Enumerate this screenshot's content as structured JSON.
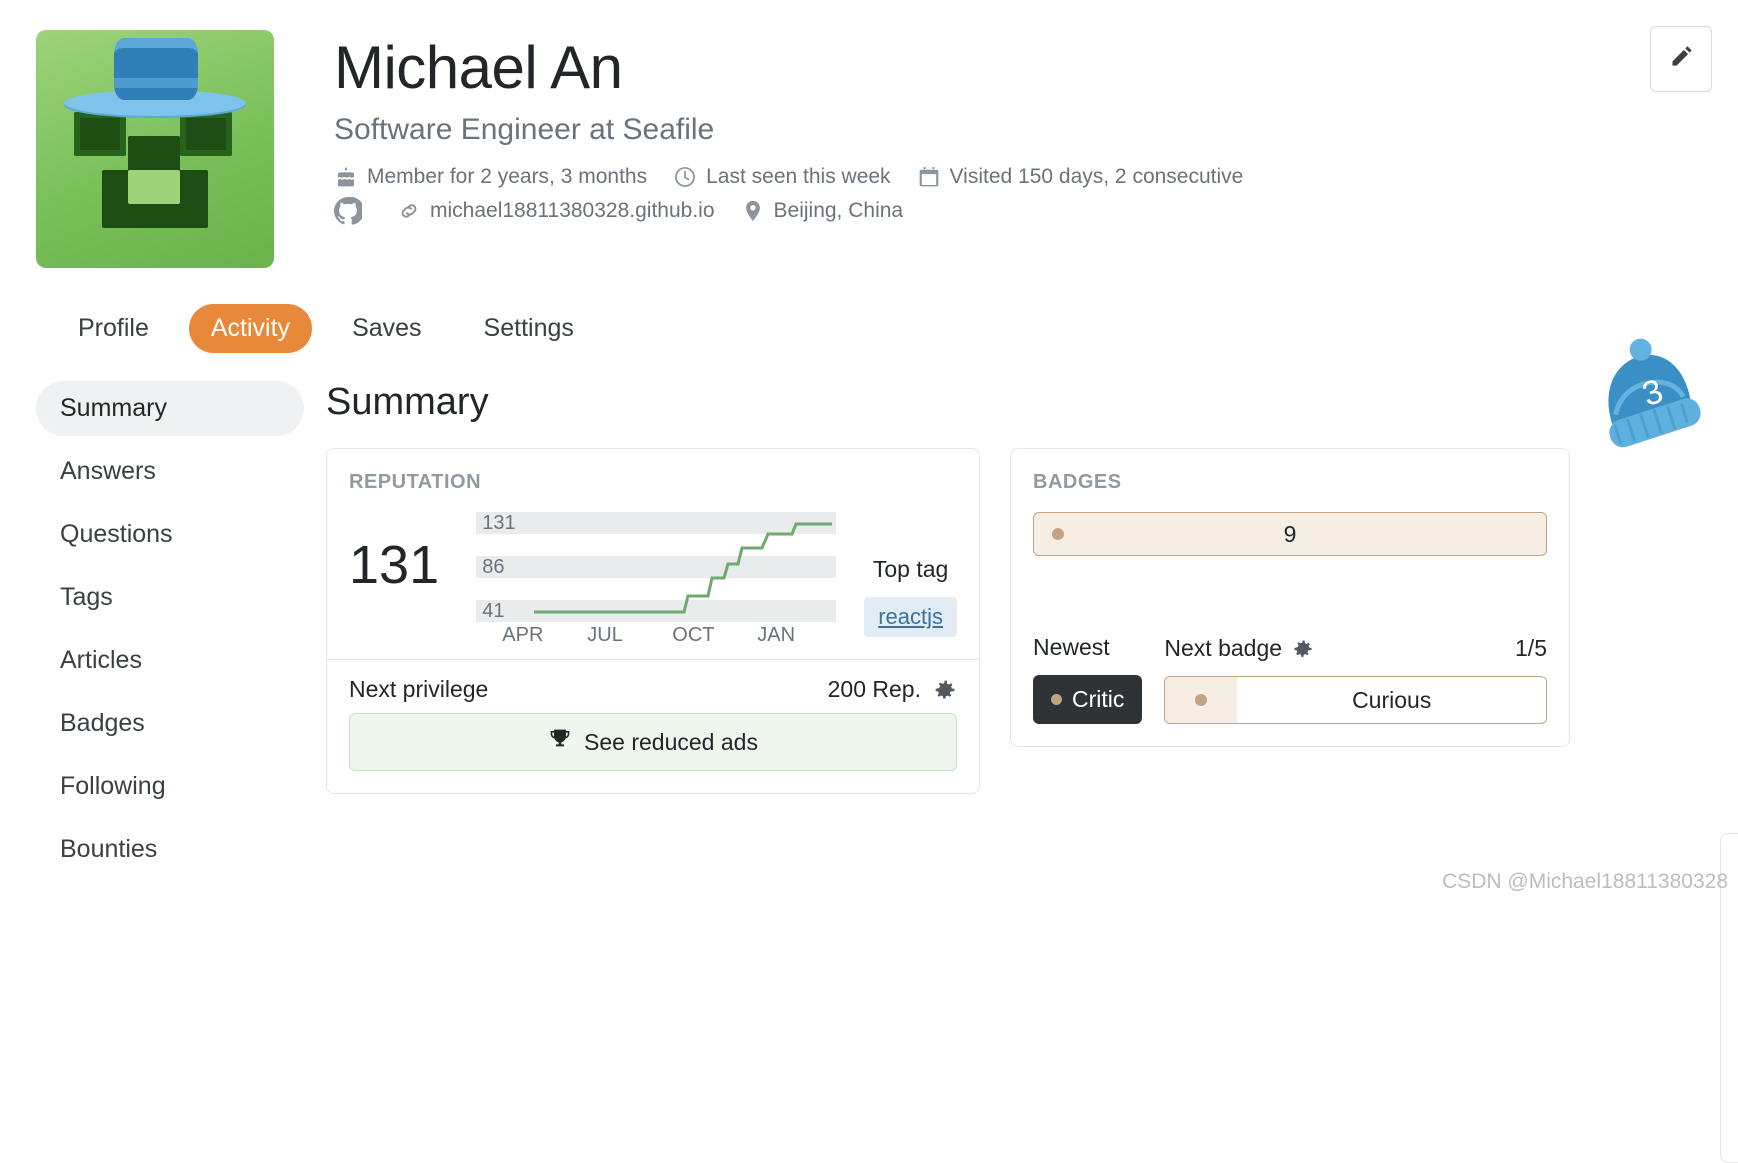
{
  "profile": {
    "name": "Michael An",
    "headline": "Software Engineer at Seafile",
    "meta_line_1": [
      {
        "icon": "cake-icon",
        "text": "Member for 2 years, 3 months"
      },
      {
        "icon": "clock-icon",
        "text": "Last seen this week"
      },
      {
        "icon": "calendar-icon",
        "text": "Visited 150 days, 2 consecutive"
      }
    ],
    "meta_line_2": [
      {
        "icon": "github-icon",
        "text": ""
      },
      {
        "icon": "link-icon",
        "text": "michael18811380328.github.io"
      },
      {
        "icon": "location-pin-icon",
        "text": "Beijing, China"
      }
    ],
    "edit_icon": "pencil-icon"
  },
  "tabs": [
    {
      "label": "Profile",
      "active": false
    },
    {
      "label": "Activity",
      "active": true
    },
    {
      "label": "Saves",
      "active": false
    },
    {
      "label": "Settings",
      "active": false
    }
  ],
  "sidebar": {
    "items": [
      {
        "label": "Summary",
        "active": true
      },
      {
        "label": "Answers",
        "active": false
      },
      {
        "label": "Questions",
        "active": false
      },
      {
        "label": "Tags",
        "active": false
      },
      {
        "label": "Articles",
        "active": false
      },
      {
        "label": "Badges",
        "active": false
      },
      {
        "label": "Following",
        "active": false
      },
      {
        "label": "Bounties",
        "active": false
      }
    ]
  },
  "main": {
    "title": "Summary"
  },
  "reputation_card": {
    "label": "REPUTATION",
    "value": "131",
    "top_tag_label": "Top tag",
    "top_tag": "reactjs",
    "next_privilege_label": "Next privilege",
    "next_privilege_points": "200 Rep.",
    "gear_icon": "gear-icon",
    "privilege_button": {
      "label": "See reduced ads",
      "icon": "trophy-icon"
    }
  },
  "badges_card": {
    "label": "BADGES",
    "bronze_count": "9",
    "newest_label": "Newest",
    "newest_badge": "Critic",
    "next_badge_label": "Next badge",
    "next_badge_name": "Curious",
    "next_badge_progress": "1/5",
    "gear_icon": "gear-icon"
  },
  "decoration": {
    "santa_hat_number": "3"
  },
  "watermark": "CSDN @Michael18811380328",
  "chart_data": {
    "type": "line",
    "title": "Reputation over time",
    "xlabel": "",
    "ylabel": "Reputation",
    "categories": [
      "APR",
      "JUL",
      "OCT",
      "JAN"
    ],
    "y_gridlines": [
      131,
      86,
      41
    ],
    "ylim": [
      41,
      131
    ],
    "grid": true,
    "legend": "none",
    "series": [
      {
        "name": "Reputation",
        "points": [
          {
            "x": "APR",
            "y": 41
          },
          {
            "x": "MAY",
            "y": 41
          },
          {
            "x": "JUN",
            "y": 41
          },
          {
            "x": "JUL",
            "y": 41
          },
          {
            "x": "AUG",
            "y": 41
          },
          {
            "x": "SEP",
            "y": 41
          },
          {
            "x": "OCT",
            "y": 41
          },
          {
            "x": "NOV",
            "y": 52
          },
          {
            "x": "DEC",
            "y": 86
          },
          {
            "x": "JAN",
            "y": 105
          },
          {
            "x": "FEB",
            "y": 118
          },
          {
            "x": "MAR",
            "y": 131
          }
        ]
      }
    ]
  },
  "colors": {
    "accent_orange": "#e8883a",
    "spark_green": "#6cab6c",
    "tag_blue": "#39739d",
    "bronze": "#c2a484",
    "muted_text": "#6a737c"
  }
}
